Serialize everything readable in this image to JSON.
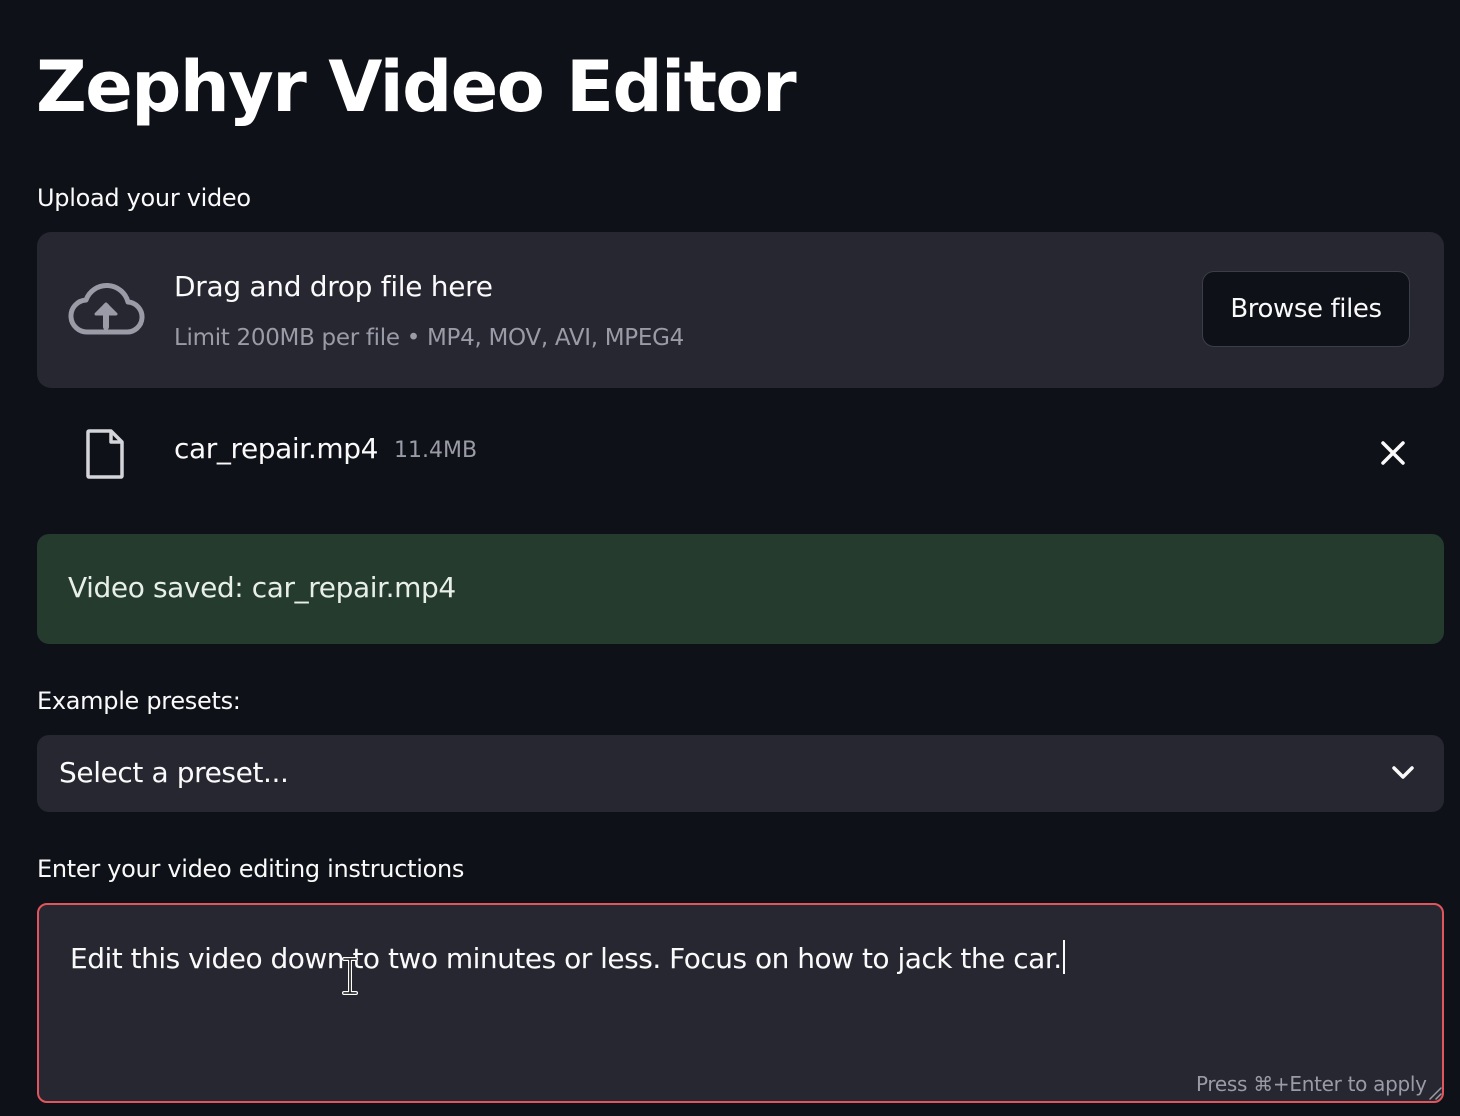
{
  "app": {
    "title": "Zephyr Video Editor"
  },
  "upload": {
    "label": "Upload your video",
    "dropzone_title": "Drag and drop file here",
    "dropzone_limit": "Limit 200MB per file • MP4, MOV, AVI, MPEG4",
    "browse_label": "Browse files",
    "icon": "cloud-upload-icon"
  },
  "uploaded_file": {
    "name": "car_repair.mp4",
    "size": "11.4MB",
    "icon": "file-icon",
    "remove_icon": "close-icon"
  },
  "status": {
    "message": "Video saved: car_repair.mp4",
    "color": "#243b2e"
  },
  "presets": {
    "label": "Example presets:",
    "selected": "Select a preset...",
    "icon": "chevron-down-icon"
  },
  "instructions": {
    "label": "Enter your video editing instructions",
    "value": "Edit this video down to two minutes or less. Focus on how to jack the car.",
    "hint": "Press ⌘+Enter to apply",
    "border_color": "#e3555c"
  },
  "colors": {
    "background": "#0e1117",
    "panel": "#262730",
    "text": "#fafafa",
    "muted": "#9a9ba6"
  }
}
